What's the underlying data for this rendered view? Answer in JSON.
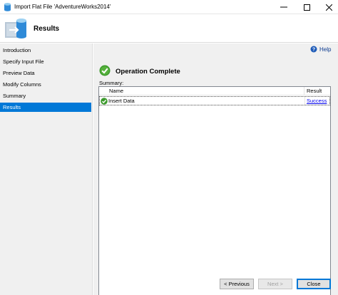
{
  "window": {
    "title": "Import Flat File 'AdventureWorks2014'"
  },
  "header": {
    "title": "Results"
  },
  "nav": {
    "items": [
      {
        "label": "Introduction"
      },
      {
        "label": "Specify Input File"
      },
      {
        "label": "Preview Data"
      },
      {
        "label": "Modify Columns"
      },
      {
        "label": "Summary"
      },
      {
        "label": "Results"
      }
    ],
    "selected": "Results"
  },
  "content": {
    "help_label": "Help",
    "operation_title": "Operation Complete",
    "summary_label": "Summary:",
    "table": {
      "columns": [
        "Name",
        "Result"
      ],
      "rows": [
        {
          "name": "Insert Data",
          "result": "Success"
        }
      ]
    }
  },
  "footer": {
    "previous_label": "< Previous",
    "next_label": "Next >",
    "close_label": "Close"
  },
  "colors": {
    "accent": "#0078d7",
    "success": "#3c9a2c",
    "link": "#0000ee"
  }
}
